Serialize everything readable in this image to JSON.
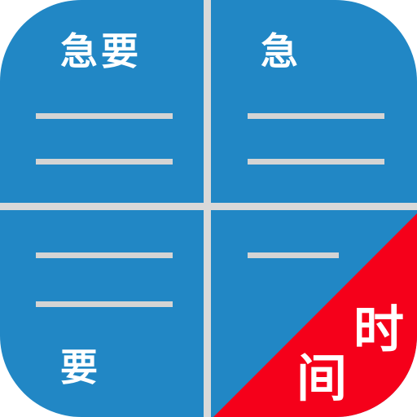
{
  "icon": {
    "colors": {
      "background": "#2187c5",
      "divider": "#d9d9d9",
      "line": "#d4d4d4",
      "corner": "#f5001a",
      "text": "#ffffff"
    },
    "quadrants": {
      "top_left": {
        "label": "急要"
      },
      "top_right": {
        "label": "急"
      },
      "bottom_left": {
        "label": "要"
      }
    },
    "corner_ribbon": {
      "char_top": "时",
      "char_bottom": "间"
    }
  }
}
